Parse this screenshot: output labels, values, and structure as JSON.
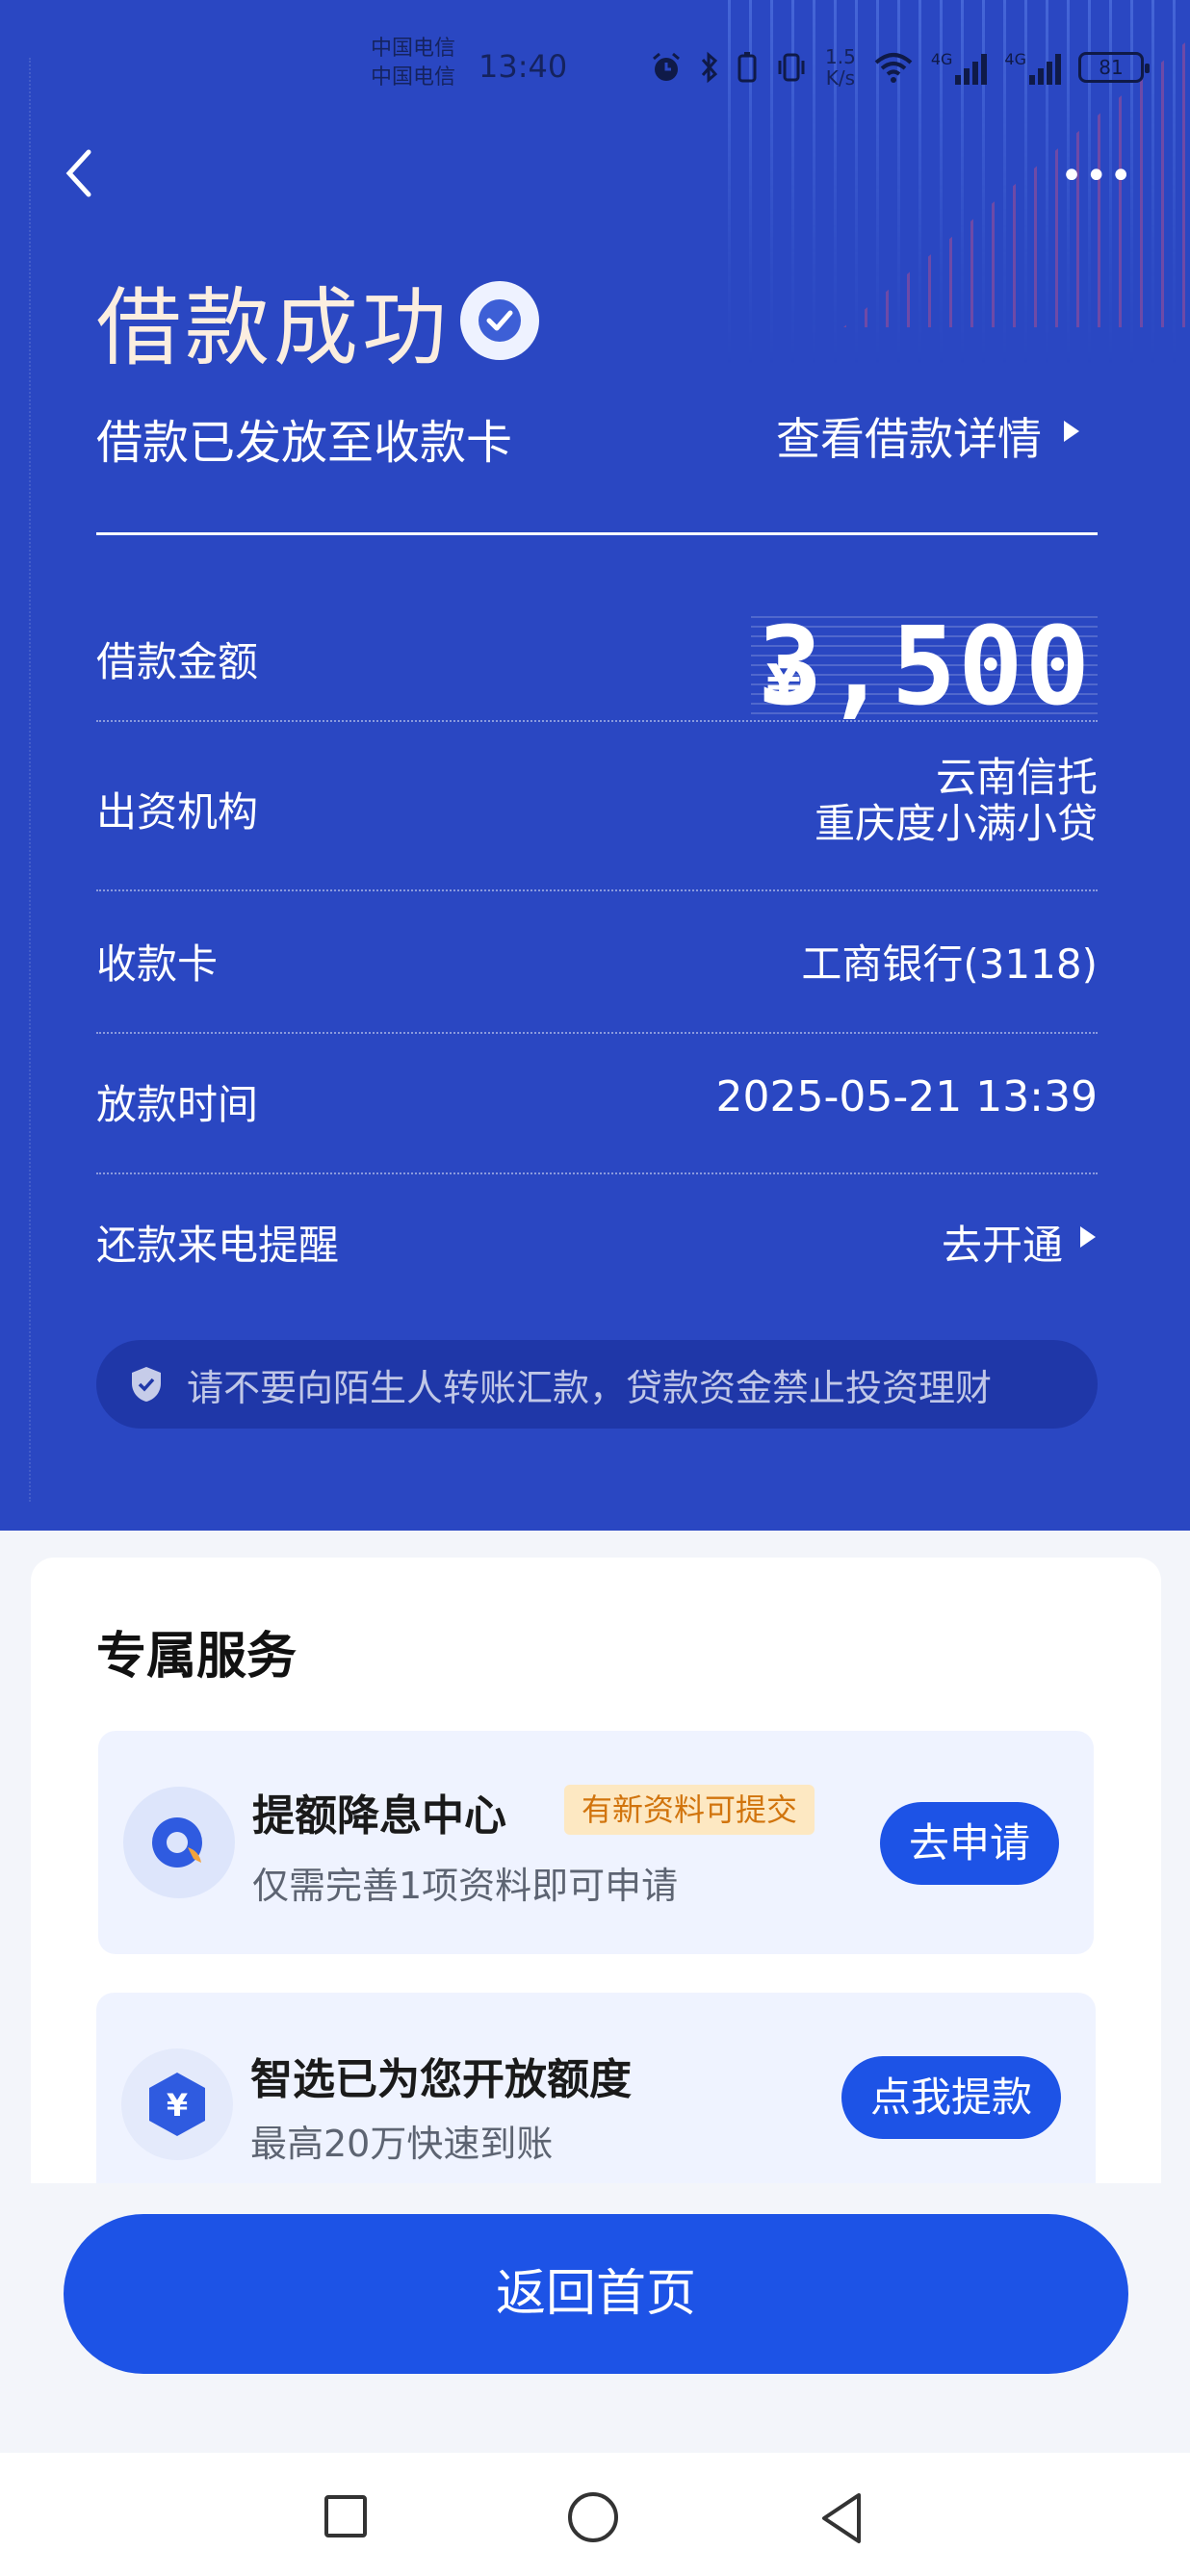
{
  "status_bar": {
    "carrier1": "中国电信",
    "carrier2": "中国电信",
    "time": "13:40",
    "net_speed_value": "1.5",
    "net_speed_unit": "K/s",
    "signal1_label": "4G",
    "signal2_label": "4G",
    "battery": "81"
  },
  "header": {
    "back_icon": "chevron-left-icon",
    "more_icon": "more-dots-icon",
    "more_label": "•••"
  },
  "success": {
    "title": "借款成功",
    "subtitle": "借款已发放至收款卡",
    "detail_link": "查看借款详情"
  },
  "details": {
    "amount_label": "借款金额",
    "amount_currency": "¥",
    "amount_value": "3,500",
    "funder_label": "出资机构",
    "funder_line1": "云南信托",
    "funder_line2": "重庆度小满小贷",
    "card_label": "收款卡",
    "card_value": "工商银行(3118)",
    "time_label": "放款时间",
    "time_value": "2025-05-21 13:39",
    "reminder_label": "还款来电提醒",
    "reminder_action": "去开通"
  },
  "warning": {
    "text": "请不要向陌生人转账汇款，贷款资金禁止投资理财"
  },
  "services": {
    "title": "专属服务",
    "items": [
      {
        "name": "提额降息中心",
        "tag": "有新资料可提交",
        "desc": "仅需完善1项资料即可申请",
        "button": "去申请"
      },
      {
        "name": "智选已为您开放额度",
        "desc": "最高20万快速到账",
        "button": "点我提款",
        "icon_glyph": "¥"
      }
    ]
  },
  "footer": {
    "home_button": "返回首页"
  },
  "colors": {
    "hero_bg": "#2a47c2",
    "primary_button": "#1d53e6",
    "tag_bg": "#fde8c2",
    "tag_text": "#d1740d"
  }
}
